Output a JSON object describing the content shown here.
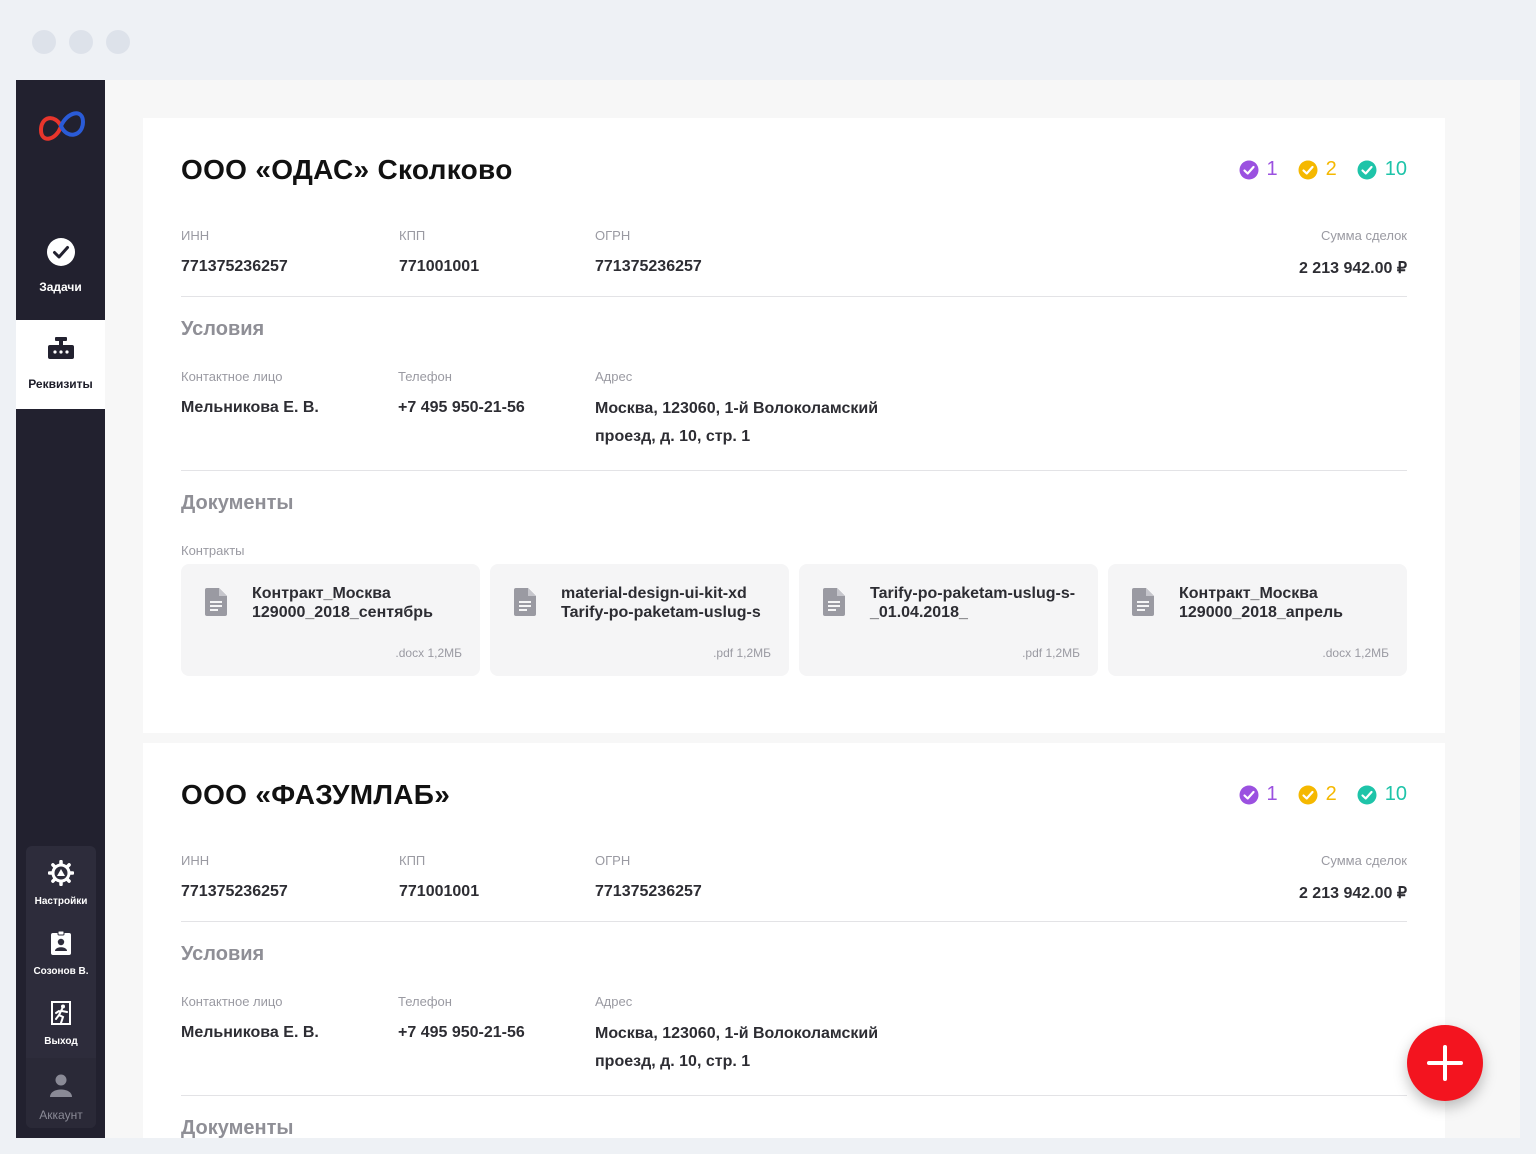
{
  "sidebar": {
    "nav": [
      {
        "label": "Задачи",
        "icon": "check-circle-icon",
        "active": false
      },
      {
        "label": "Реквизиты",
        "icon": "requisites-icon",
        "active": true
      }
    ],
    "bottom": [
      {
        "label": "Настройки",
        "icon": "gear-icon"
      },
      {
        "label": "Созонов В.",
        "icon": "id-badge-icon"
      },
      {
        "label": "Выход",
        "icon": "exit-icon"
      },
      {
        "label": "Аккаунт",
        "icon": "user-icon"
      }
    ]
  },
  "colors": {
    "purple": "#9b51e0",
    "yellow": "#f5b800",
    "teal": "#1ec4a9",
    "fab": "#f3141f",
    "sidebar": "#22212f"
  },
  "labels": {
    "inn": "ИНН",
    "kpp": "КПП",
    "ogrn": "ОГРН",
    "sum": "Сумма сделок",
    "conditions": "Условия",
    "contact": "Контактное лицо",
    "phone": "Телефон",
    "address": "Адрес",
    "documents": "Документы",
    "contracts": "Контракты"
  },
  "companies": [
    {
      "name": "ООО «ОДАС» Сколково",
      "badges": [
        "1",
        "2",
        "10"
      ],
      "inn": "771375236257",
      "kpp": "771001001",
      "ogrn": "771375236257",
      "sum": "2 213 942.00 ₽",
      "contact": "Мельникова Е. В.",
      "phone": "+7 495 950-21-56",
      "address": "Москва, 123060, 1-й Волоколамский проезд, д. 10, стр. 1",
      "docs": [
        {
          "name": "Контракт_Москва 129000_2018_сентябрь",
          "meta": ".docx 1,2МБ"
        },
        {
          "name": "material-design-ui-kit-xd Tarify-po-paketam-uslug-s",
          "meta": ".pdf 1,2МБ"
        },
        {
          "name": "Tarify-po-paketam-uslug-s-_01.04.2018_",
          "meta": ".pdf 1,2МБ"
        },
        {
          "name": "Контракт_Москва 129000_2018_апрель",
          "meta": ".docx 1,2МБ"
        }
      ]
    },
    {
      "name": "ООО «ФАЗУМЛАБ»",
      "badges": [
        "1",
        "2",
        "10"
      ],
      "inn": "771375236257",
      "kpp": "771001001",
      "ogrn": "771375236257",
      "sum": "2 213 942.00 ₽",
      "contact": "Мельникова Е. В.",
      "phone": "+7 495 950-21-56",
      "address": "Москва, 123060, 1-й Волоколамский проезд, д. 10, стр. 1"
    }
  ]
}
